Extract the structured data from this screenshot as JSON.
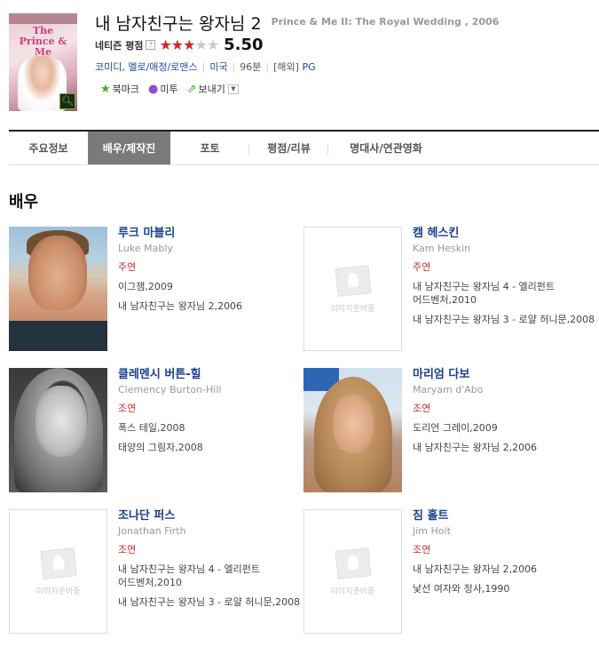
{
  "movie": {
    "title_ko": "내 남자친구는 왕자님 2",
    "title_en": "Prince & Me II: The Royal Wedding , 2006",
    "poster_title": "The Prince & Me",
    "rating_label": "네티즌 평점",
    "rating_help": "?",
    "rating_value": "5.50",
    "rating_stars": 3,
    "rating_max": 5,
    "genre": "코미디, 멜로/애정/로맨스",
    "country": "미국",
    "runtime": "96분",
    "release": "[해외]",
    "grade": "PG"
  },
  "actions": {
    "bookmark": "북마크",
    "me2": "미투",
    "send": "보내기"
  },
  "tabs": [
    "주요정보",
    "배우/제작진",
    "포토",
    "평점/리뷰",
    "명대사/연관영화"
  ],
  "active_tab": 1,
  "section_title": "배우",
  "placeholder_text": "이미지준비중",
  "people": [
    {
      "name": "루크 마블리",
      "name_en": "Luke Mably",
      "role": "주연",
      "works": [
        "이그잼,2009",
        "내 남자친구는 왕자님 2,2006"
      ]
    },
    {
      "name": "캠 헤스킨",
      "name_en": "Kam Heskin",
      "role": "주연",
      "works": [
        "내 남자친구는 왕자님 4 - 엘리펀트 어드벤처,2010",
        "내 남자친구는 왕자님 3 - 로얄 허니문,2008"
      ]
    },
    {
      "name": "클레멘시 버튼-힐",
      "name_en": "Clemency Burton-Hill",
      "role": "조연",
      "works": [
        "폭스 테일,2008",
        "태양의 그림자,2008"
      ]
    },
    {
      "name": "마리엄 다보",
      "name_en": "Maryam d'Abo",
      "role": "조연",
      "works": [
        "도리언 그레이,2009",
        "내 남자친구는 왕자님 2,2006"
      ]
    },
    {
      "name": "조나단 퍼스",
      "name_en": "Jonathan Firth",
      "role": "조연",
      "works": [
        "내 남자친구는 왕자님 4 - 엘리펀트 어드벤처,2010",
        "내 남자친구는 왕자님 3 - 로얄 허니문,2008"
      ]
    },
    {
      "name": "짐 홀트",
      "name_en": "Jim Holt",
      "role": "조연",
      "works": [
        "내 남자친구는 왕자님 2,2006",
        "낯선 여자와 정사,1990"
      ]
    }
  ]
}
